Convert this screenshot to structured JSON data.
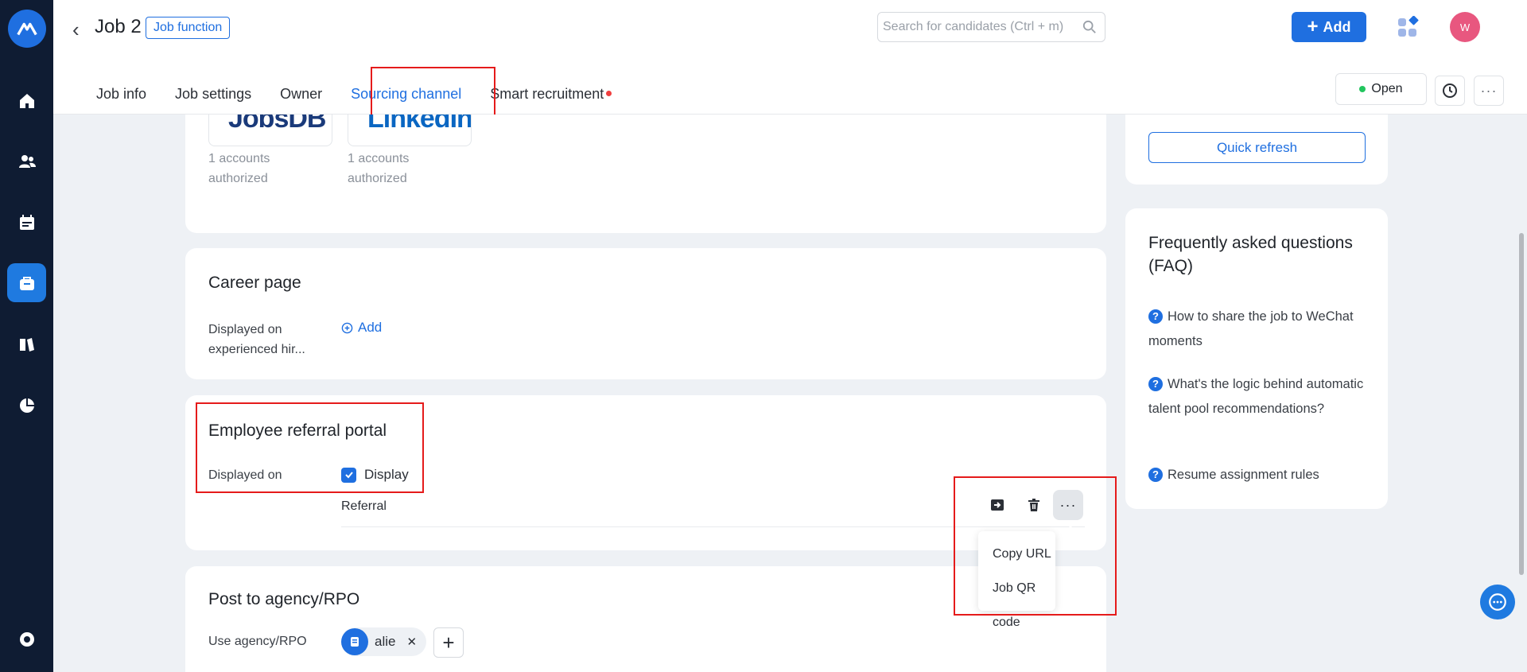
{
  "job": {
    "title": "Job 2",
    "tag": "Job function"
  },
  "search": {
    "placeholder": "Search for candidates (Ctrl + m)"
  },
  "header": {
    "add_label": "Add",
    "avatar_initial": "W"
  },
  "tabs": [
    {
      "label": "Job info"
    },
    {
      "label": "Job settings"
    },
    {
      "label": "Owner"
    },
    {
      "label": "Sourcing channel"
    },
    {
      "label": "Smart recruitment"
    }
  ],
  "status": {
    "label": "Open"
  },
  "channels": [
    {
      "name": "JobsDB",
      "logo_text": "JobsDB",
      "accounts_line1": "1 accounts",
      "accounts_line2": "authorized"
    },
    {
      "name": "LinkedIn",
      "logo_text": "LinkedIn",
      "accounts_line1": "1 accounts",
      "accounts_line2": "authorized"
    }
  ],
  "career_page": {
    "title": "Career page",
    "displayed_on": "Displayed on experienced hir...",
    "add_label": "Add"
  },
  "referral": {
    "title": "Employee referral portal",
    "displayed_on": "Displayed on",
    "display_label": "Display",
    "row_label": "Referral"
  },
  "menu": {
    "items": [
      "Copy URL",
      "Job QR code"
    ]
  },
  "agency": {
    "title": "Post to agency/RPO",
    "use_label": "Use agency/RPO",
    "chip": "alie"
  },
  "right": {
    "quick_refresh": "Quick refresh",
    "faq_title": "Frequently asked questions (FAQ)",
    "faq": [
      "How to share the job to WeChat moments",
      "What's the logic behind automatic talent pool recommendations?",
      "Resume assignment rules"
    ]
  },
  "colors": {
    "primary": "#1f6fe0",
    "nav": "#0f1c33",
    "highlight": "#e51b1b",
    "open": "#22c55e"
  }
}
